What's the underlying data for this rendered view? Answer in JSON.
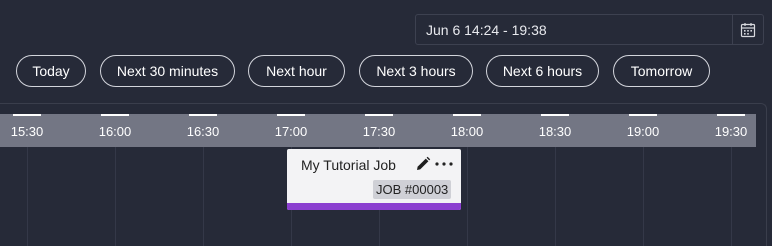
{
  "date_range": {
    "value": "Jun 6 14:24 - 19:38",
    "icon": "calendar-icon"
  },
  "presets": [
    {
      "key": "today",
      "label": "Today"
    },
    {
      "key": "next-30-minutes",
      "label": "Next 30 minutes"
    },
    {
      "key": "next-hour",
      "label": "Next hour"
    },
    {
      "key": "next-3-hours",
      "label": "Next 3 hours"
    },
    {
      "key": "next-6-hours",
      "label": "Next 6 hours"
    },
    {
      "key": "tomorrow",
      "label": "Tomorrow"
    }
  ],
  "timeline": {
    "ticks": [
      "15:30",
      "16:00",
      "16:30",
      "17:00",
      "17:30",
      "18:00",
      "18:30",
      "19:00",
      "19:30"
    ]
  },
  "job": {
    "title": "My Tutorial Job",
    "badge": "JOB #00003",
    "accent_color": "#8b3fd0",
    "edit_icon": "pencil-icon",
    "more_icon": "more-horizontal-icon"
  }
}
